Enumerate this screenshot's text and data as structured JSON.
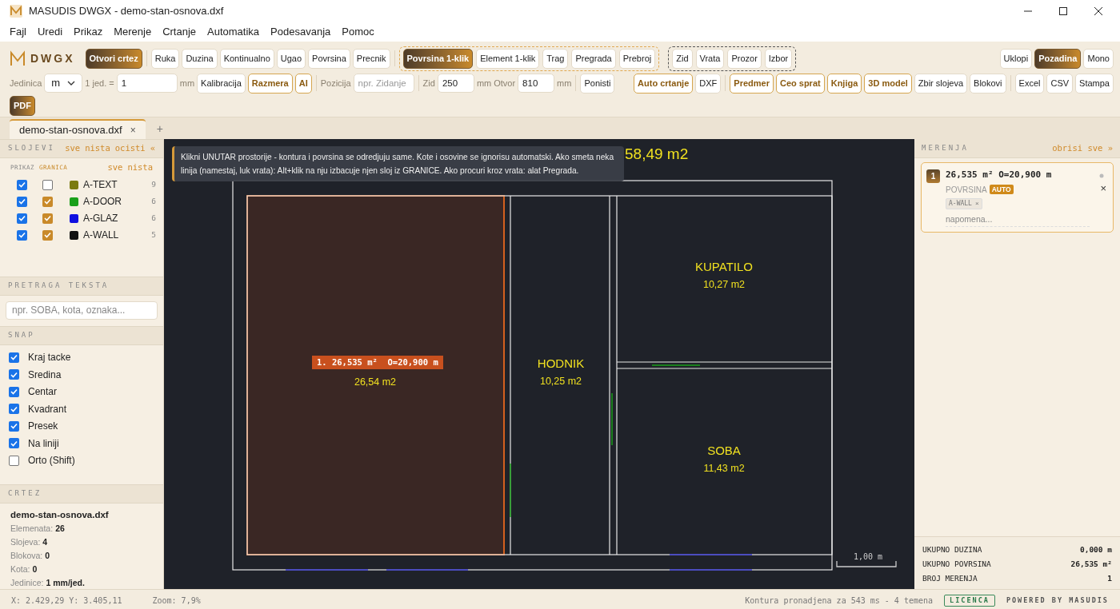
{
  "window": {
    "title": "MASUDIS DWGX - demo-stan-osnova.dxf"
  },
  "menu": [
    "Fajl",
    "Uredi",
    "Prikaz",
    "Merenje",
    "Crtanje",
    "Automatika",
    "Podesavanja",
    "Pomoc"
  ],
  "logo": {
    "text": "DWGX"
  },
  "toolbar": [
    {
      "items": [
        {
          "kind": "primary",
          "label": "Otvori crtez"
        },
        {
          "kind": "separator"
        },
        {
          "kind": "button",
          "label": "Ruka"
        },
        {
          "kind": "button",
          "label": "Duzina"
        },
        {
          "kind": "button",
          "label": "Kontinualno"
        },
        {
          "kind": "button",
          "label": "Ugao"
        },
        {
          "kind": "button",
          "label": "Povrsina"
        },
        {
          "kind": "button",
          "label": "Precnik"
        },
        {
          "kind": "separator"
        },
        {
          "kind": "accent-group",
          "items": [
            {
              "label": "Povrsina 1-klik",
              "selected": true
            },
            {
              "label": "Element 1-klik",
              "selected": false
            },
            {
              "label": "Trag",
              "selected": false
            },
            {
              "label": "Pregrada",
              "selected": false
            },
            {
              "label": "Prebroj",
              "selected": false
            }
          ]
        },
        {
          "kind": "group",
          "items": [
            {
              "label": "Zid",
              "selected": false
            },
            {
              "label": "Vrata",
              "selected": false
            },
            {
              "label": "Prozor",
              "selected": false
            },
            {
              "label": "Izbor",
              "selected": false
            }
          ]
        },
        {
          "kind": "spacer"
        },
        {
          "kind": "toggle",
          "label": "Uklopi",
          "selected": false
        },
        {
          "kind": "toggle",
          "label": "Pozadina",
          "selected": true
        },
        {
          "kind": "toggle",
          "label": "Mono",
          "selected": false
        }
      ]
    },
    {
      "items": [
        {
          "kind": "label",
          "text": "Jedinica"
        },
        {
          "kind": "select",
          "value": "m"
        },
        {
          "kind": "label",
          "text": "1 jed. ="
        },
        {
          "kind": "input",
          "value": "1"
        },
        {
          "kind": "label",
          "text": "mm"
        },
        {
          "kind": "button",
          "label": "Kalibracija"
        },
        {
          "kind": "accent",
          "label": "Razmera"
        },
        {
          "kind": "accent",
          "label": "AI"
        },
        {
          "kind": "separator"
        },
        {
          "kind": "label",
          "text": "Pozicija"
        },
        {
          "kind": "input",
          "placeholder": "npr. Zidanje"
        },
        {
          "kind": "separator"
        },
        {
          "kind": "label",
          "text": "Zid"
        },
        {
          "kind": "number",
          "value": "250"
        },
        {
          "kind": "label",
          "text": "mm"
        },
        {
          "kind": "label",
          "text": "Otvor"
        },
        {
          "kind": "number",
          "value": "810"
        },
        {
          "kind": "label",
          "text": "mm"
        },
        {
          "kind": "separator"
        },
        {
          "kind": "button",
          "label": "Ponisti"
        },
        {
          "kind": "spacer"
        },
        {
          "kind": "accent",
          "label": "Auto crtanje"
        },
        {
          "kind": "button",
          "label": "DXF"
        },
        {
          "kind": "separator"
        },
        {
          "kind": "accent",
          "label": "Predmer"
        },
        {
          "kind": "accent",
          "label": "Ceo sprat"
        },
        {
          "kind": "accent",
          "label": "Knjiga"
        },
        {
          "kind": "accent",
          "label": "3D model"
        },
        {
          "kind": "button",
          "label": "Zbir slojeva"
        },
        {
          "kind": "button",
          "label": "Blokovi"
        },
        {
          "kind": "separator"
        },
        {
          "kind": "button",
          "label": "Excel"
        },
        {
          "kind": "button",
          "label": "CSV"
        },
        {
          "kind": "button",
          "label": "Stampa"
        }
      ]
    },
    {
      "items": [
        {
          "kind": "primary",
          "label": "PDF"
        }
      ]
    }
  ],
  "tabs": [
    {
      "label": "demo-stan-osnova.dxf",
      "close": "×",
      "selected": true
    }
  ],
  "new_tab": "+",
  "layers": {
    "title": "SLOJEVI",
    "links": [
      "sve",
      "nista",
      "ocisti",
      "«"
    ],
    "col_show": "PRIKAZ",
    "col_boundary": "GRANICA",
    "col_links": [
      "sve",
      "nista"
    ],
    "items": [
      {
        "name": "A-TEXT",
        "shown": true,
        "boundary": false,
        "color": "#7a7a10",
        "count": "9"
      },
      {
        "name": "A-DOOR",
        "shown": true,
        "boundary": true,
        "color": "#1aa01a",
        "count": "6"
      },
      {
        "name": "A-GLAZ",
        "shown": true,
        "boundary": true,
        "color": "#1010e0",
        "count": "6"
      },
      {
        "name": "A-WALL",
        "shown": true,
        "boundary": true,
        "color": "#111111",
        "count": "5"
      }
    ]
  },
  "text_search": {
    "title": "PRETRAGA TEKSTA",
    "placeholder": "npr. SOBA, kota, oznaka..."
  },
  "snap": {
    "title": "SNAP",
    "items": [
      {
        "label": "Kraj tacke",
        "checked": true
      },
      {
        "label": "Sredina",
        "checked": true
      },
      {
        "label": "Centar",
        "checked": true
      },
      {
        "label": "Kvadrant",
        "checked": true
      },
      {
        "label": "Presek",
        "checked": true
      },
      {
        "label": "Na liniji",
        "checked": true
      },
      {
        "label": "Orto (Shift)",
        "checked": false
      }
    ]
  },
  "drawing_info": {
    "title": "CRTEZ",
    "file": "demo-stan-osnova.dxf",
    "stats": [
      {
        "label": "Elemenata:",
        "value": "26"
      },
      {
        "label": "Slojeva:",
        "value": "4"
      },
      {
        "label": "Blokova:",
        "value": "0"
      },
      {
        "label": "Kota:",
        "value": "0"
      },
      {
        "label": "Jedinice:",
        "value": "1 mm/jed."
      }
    ]
  },
  "canvas": {
    "total_area": "58,49 m2",
    "hint": "Klikni UNUTAR prostorije - kontura i povrsina se odredjuju same. Kote i osovine se ignorisu automatski. Ako smeta neka linija (namestaj, luk vrata): Alt+klik na nju izbacuje njen sloj iz GRANICE. Ako procuri kroz vrata: alat Pregrada.",
    "rooms": [
      {
        "name": "KUPATILO",
        "area": "10,27 m2"
      },
      {
        "name": "HODNIK",
        "area": "10,25 m2"
      },
      {
        "name": "SOBA",
        "area": "11,43 m2"
      }
    ],
    "measured_area": "26,54 m2",
    "measure_label": "1. 26,535 m²  O=20,900 m",
    "scale": "1,00 m"
  },
  "measurements": {
    "title": "MERENJA",
    "clear": "obrisi sve »",
    "items": [
      {
        "number": "1",
        "value": "26,535 m² O=20,900 m",
        "type": "POVRSINA",
        "badge": "AUTO",
        "tags": [
          {
            "label": "A-WALL",
            "remove": "×"
          }
        ],
        "note_placeholder": "napomena...",
        "close": "×"
      }
    ],
    "totals": [
      {
        "label": "UKUPNO DUZINA",
        "value": "0,000 m"
      },
      {
        "label": "UKUPNO POVRSINA",
        "value": "26,535 m²"
      },
      {
        "label": "BROJ MERENJA",
        "value": "1"
      }
    ]
  },
  "status_bar": {
    "coords": "X: 2.429,29 Y: 3.405,11",
    "zoom": "Zoom: 7,9%",
    "message": "Kontura pronadjena za 543 ms - 4 temena",
    "license": "LICENCA",
    "powered": "POWERED BY MASUDIS"
  }
}
